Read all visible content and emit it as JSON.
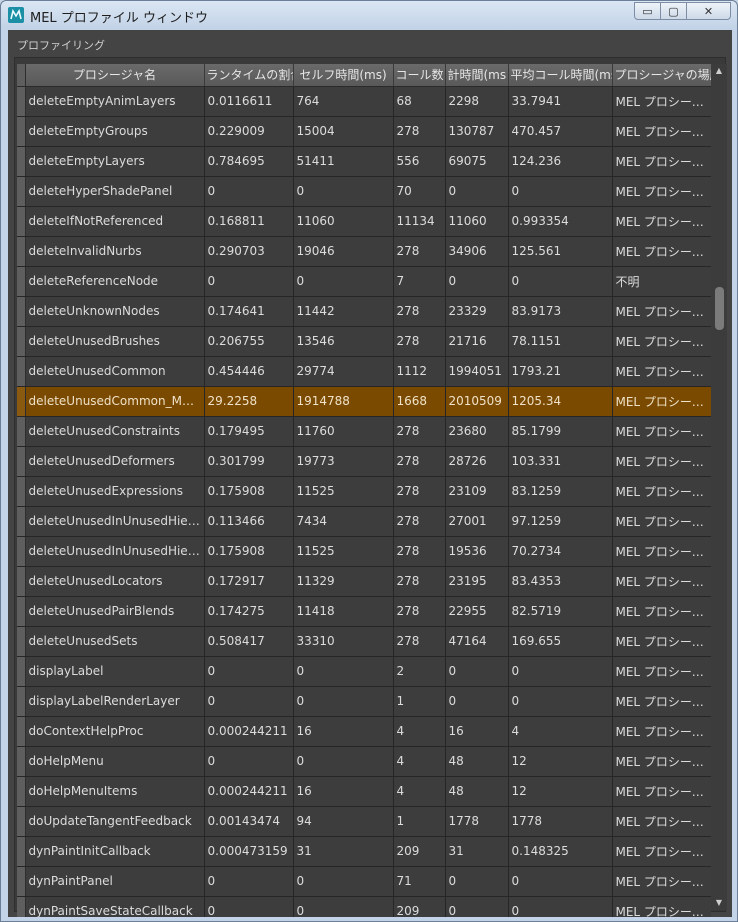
{
  "window": {
    "title": "MEL プロファイル ウィンドウ",
    "minimize_label": "▭",
    "maximize_label": "▢",
    "close_label": "✕"
  },
  "group": {
    "title": "プロファイリング"
  },
  "table": {
    "columns": [
      "プロシージャ名",
      "ランタイムの割合",
      "セルフ時間(ms)",
      "コール数",
      "計時間(ms",
      "平均コール時間(ms",
      "プロシージャの場所"
    ],
    "selected_row": 10,
    "rows": [
      [
        "deleteEmptyAnimLayers",
        "0.0116611",
        "764",
        "68",
        "2298",
        "33.7941",
        "MEL プロシージャ…"
      ],
      [
        "deleteEmptyGroups",
        "0.229009",
        "15004",
        "278",
        "130787",
        "470.457",
        "MEL プロシージャ…"
      ],
      [
        "deleteEmptyLayers",
        "0.784695",
        "51411",
        "556",
        "69075",
        "124.236",
        "MEL プロシージャ…"
      ],
      [
        "deleteHyperShadePanel",
        "0",
        "0",
        "70",
        "0",
        "0",
        "MEL プロシージャ…"
      ],
      [
        "deleteIfNotReferenced",
        "0.168811",
        "11060",
        "11134",
        "11060",
        "0.993354",
        "MEL プロシージャ…"
      ],
      [
        "deleteInvalidNurbs",
        "0.290703",
        "19046",
        "278",
        "34906",
        "125.561",
        "MEL プロシージャ…"
      ],
      [
        "deleteReferenceNode",
        "0",
        "0",
        "7",
        "0",
        "0",
        "不明"
      ],
      [
        "deleteUnknownNodes",
        "0.174641",
        "11442",
        "278",
        "23329",
        "83.9173",
        "MEL プロシージャ…"
      ],
      [
        "deleteUnusedBrushes",
        "0.206755",
        "13546",
        "278",
        "21716",
        "78.1151",
        "MEL プロシージャ…"
      ],
      [
        "deleteUnusedCommon",
        "0.454446",
        "29774",
        "1112",
        "1994051",
        "1793.21",
        "MEL プロシージャ…"
      ],
      [
        "deleteUnusedCommon_Multi",
        "29.2258",
        "1914788",
        "1668",
        "2010509",
        "1205.34",
        "MEL プロシージャ…"
      ],
      [
        "deleteUnusedConstraints",
        "0.179495",
        "11760",
        "278",
        "23680",
        "85.1799",
        "MEL プロシージャ…"
      ],
      [
        "deleteUnusedDeformers",
        "0.301799",
        "19773",
        "278",
        "28726",
        "103.331",
        "MEL プロシージャ…"
      ],
      [
        "deleteUnusedExpressions",
        "0.175908",
        "11525",
        "278",
        "23109",
        "83.1259",
        "MEL プロシージャ…"
      ],
      [
        "deleteUnusedInUnusedHier…",
        "0.113466",
        "7434",
        "278",
        "27001",
        "97.1259",
        "MEL プロシージャ…"
      ],
      [
        "deleteUnusedInUnusedHier…",
        "0.175908",
        "11525",
        "278",
        "19536",
        "70.2734",
        "MEL プロシージャ…"
      ],
      [
        "deleteUnusedLocators",
        "0.172917",
        "11329",
        "278",
        "23195",
        "83.4353",
        "MEL プロシージャ…"
      ],
      [
        "deleteUnusedPairBlends",
        "0.174275",
        "11418",
        "278",
        "22955",
        "82.5719",
        "MEL プロシージャ…"
      ],
      [
        "deleteUnusedSets",
        "0.508417",
        "33310",
        "278",
        "47164",
        "169.655",
        "MEL プロシージャ…"
      ],
      [
        "displayLabel",
        "0",
        "0",
        "2",
        "0",
        "0",
        "MEL プロシージャ…"
      ],
      [
        "displayLabelRenderLayer",
        "0",
        "0",
        "1",
        "0",
        "0",
        "MEL プロシージャ…"
      ],
      [
        "doContextHelpProc",
        "0.000244211",
        "16",
        "4",
        "16",
        "4",
        "MEL プロシージャ…"
      ],
      [
        "doHelpMenu",
        "0",
        "0",
        "4",
        "48",
        "12",
        "MEL プロシージャ…"
      ],
      [
        "doHelpMenuItems",
        "0.000244211",
        "16",
        "4",
        "48",
        "12",
        "MEL プロシージャ…"
      ],
      [
        "doUpdateTangentFeedback",
        "0.00143474",
        "94",
        "1",
        "1778",
        "1778",
        "MEL プロシージャ…"
      ],
      [
        "dynPaintInitCallback",
        "0.000473159",
        "31",
        "209",
        "31",
        "0.148325",
        "MEL プロシージャ…"
      ],
      [
        "dynPaintPanel",
        "0",
        "0",
        "71",
        "0",
        "0",
        "MEL プロシージャ…"
      ],
      [
        "dynPaintSaveStateCallback",
        "0",
        "0",
        "209",
        "0",
        "0",
        "MEL プロシージャ…"
      ]
    ]
  },
  "scrollbar": {
    "position_fraction": 0.27,
    "up_icon": "▲",
    "down_icon": "▼"
  }
}
